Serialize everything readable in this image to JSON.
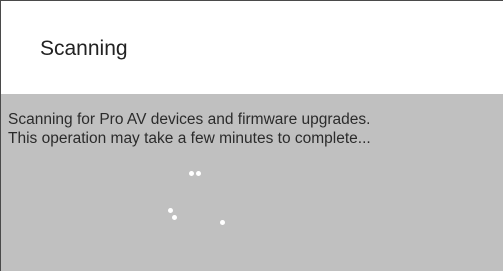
{
  "dialog": {
    "title": "Scanning",
    "message_line1": "Scanning for Pro AV devices and firmware upgrades.",
    "message_line2": "This operation may take a few minutes to complete..."
  },
  "spinner": {
    "icon": "loading-spinner-icon",
    "color": "#ffffff"
  },
  "colors": {
    "header_background": "#ffffff",
    "body_background": "#c0c0c0",
    "text": "#2b2b2b"
  }
}
